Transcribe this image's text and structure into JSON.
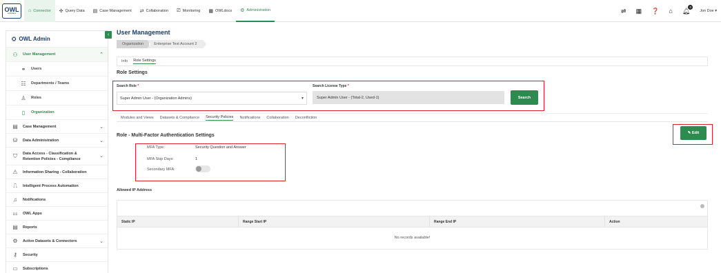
{
  "logo": {
    "main": "OWL",
    "sub": "software"
  },
  "nav": {
    "tabs": [
      {
        "label": "Connector",
        "icon": "home-icon"
      },
      {
        "label": "Query Data",
        "icon": "query-icon"
      },
      {
        "label": "Case Management",
        "icon": "case-icon"
      },
      {
        "label": "Collaboration",
        "icon": "collaboration-icon"
      },
      {
        "label": "Monitoring",
        "icon": "monitoring-icon"
      },
      {
        "label": "OWLdocs",
        "icon": "docs-icon"
      },
      {
        "label": "Administration",
        "icon": "admin-icon"
      }
    ],
    "notifications_count": "0",
    "user_name": "Jon Doe"
  },
  "sidebar": {
    "title": "OWL Admin",
    "items": [
      {
        "label": "User Management"
      },
      {
        "label": "Users"
      },
      {
        "label": "Departments / Teams"
      },
      {
        "label": "Roles"
      },
      {
        "label": "Organization"
      },
      {
        "label": "Case Management"
      },
      {
        "label": "Data Administration"
      },
      {
        "label": "Data Access - Classification &",
        "label2": "Retention Policies - Compliance"
      },
      {
        "label": "Information Sharing - Collaboration"
      },
      {
        "label": "Intelligent Process Automation"
      },
      {
        "label": "Notifications"
      },
      {
        "label": "OWL Apps"
      },
      {
        "label": "Reports"
      },
      {
        "label": "Active Datasets & Connectors"
      },
      {
        "label": "Security"
      },
      {
        "label": "Subscriptions"
      }
    ]
  },
  "main": {
    "title": "User Management",
    "breadcrumb": [
      "Organization",
      "Enterprise Test Account 2"
    ],
    "tabs": [
      "Info",
      "Role Settings"
    ],
    "section_title": "Role Settings",
    "search_role_label": "Search Role",
    "search_role_value": "Super Admin User - (Organization Admins)",
    "license_label": "Search License Type",
    "license_value": "Super Admin User - (Total-2, Used-1)",
    "search_button": "Search",
    "policy_tabs": [
      "Modules and Views",
      "Datasets & Compliance",
      "Security Policies",
      "Notifications",
      "Collaboration",
      "Deconfliction"
    ],
    "mfa_title": "Role - Multi-Factor Authentication Settings",
    "edit_button": "Edit",
    "mfa": {
      "type_label": "MFA Type:",
      "type_value": "Security Question and Answer",
      "skip_label": "MFA Skip Days:",
      "skip_value": "1",
      "secondary_label": "Secondary MFA:"
    },
    "allowed_ip_title": "Allowed IP Address",
    "grid_columns": [
      "Static IP",
      "Range Start IP",
      "Range End IP",
      "Action"
    ],
    "empty_text": "No records available!"
  }
}
